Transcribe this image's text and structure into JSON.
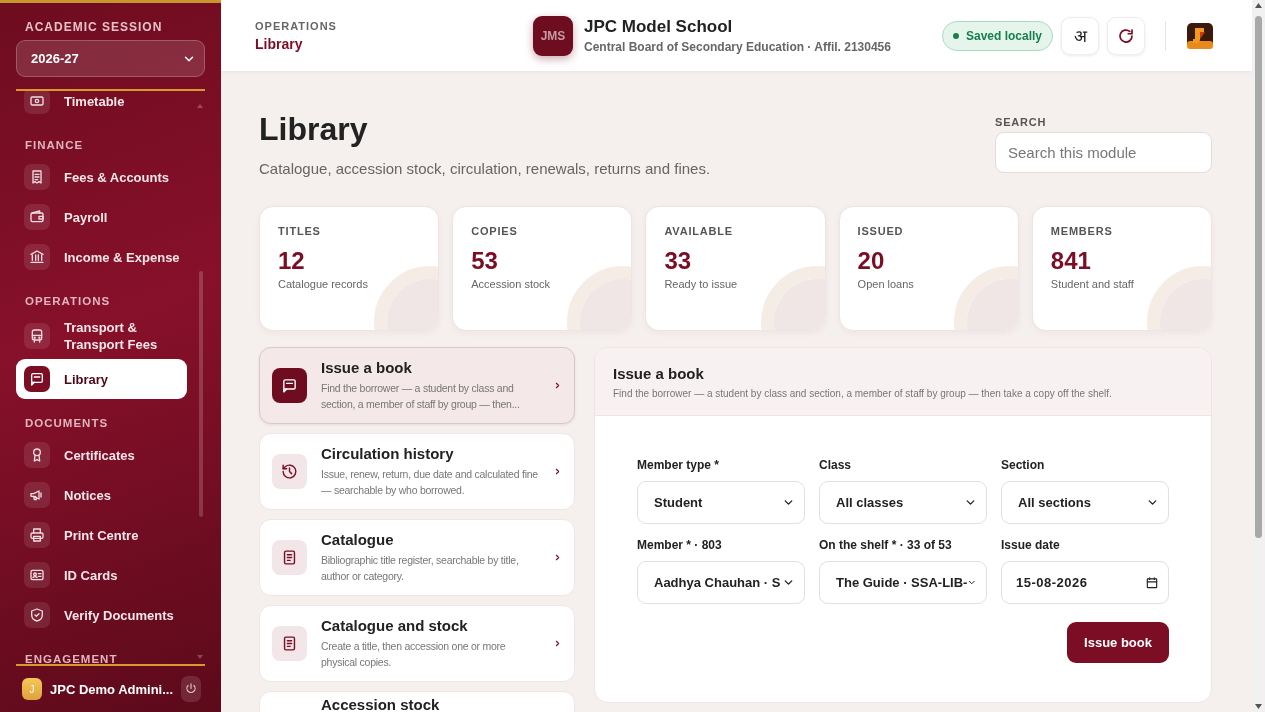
{
  "sidebar": {
    "session_label": "ACADEMIC SESSION",
    "session_value": "2026-27",
    "sections": [
      {
        "items": [
          {
            "label": "Timetable",
            "selected": false
          }
        ]
      },
      {
        "title": "FINANCE",
        "items": [
          {
            "label": "Fees & Accounts",
            "selected": false
          },
          {
            "label": "Payroll",
            "selected": false
          },
          {
            "label": "Income & Expense",
            "selected": false
          }
        ]
      },
      {
        "title": "OPERATIONS",
        "items": [
          {
            "label": "Transport & Transport Fees",
            "selected": false
          },
          {
            "label": "Library",
            "selected": true
          }
        ]
      },
      {
        "title": "DOCUMENTS",
        "items": [
          {
            "label": "Certificates",
            "selected": false
          },
          {
            "label": "Notices",
            "selected": false
          },
          {
            "label": "Print Centre",
            "selected": false
          },
          {
            "label": "ID Cards",
            "selected": false
          },
          {
            "label": "Verify Documents",
            "selected": false
          }
        ]
      },
      {
        "title": "ENGAGEMENT"
      }
    ],
    "user": {
      "initial": "J",
      "name": "JPC Demo Admini..."
    }
  },
  "header": {
    "breadcrumb_section": "OPERATIONS",
    "breadcrumb_page": "Library",
    "school_badge": "JMS",
    "school_name": "JPC Model School",
    "school_subtitle": "Central Board of Secondary Education · Affil. 2130456",
    "status": "Saved locally",
    "language_button": "अ"
  },
  "page": {
    "title": "Library",
    "subtitle": "Catalogue, accession stock, circulation, renewals, returns and fines.",
    "search": {
      "label": "SEARCH",
      "placeholder": "Search this module"
    }
  },
  "stats": [
    {
      "label": "TITLES",
      "value": "12",
      "note": "Catalogue records"
    },
    {
      "label": "COPIES",
      "value": "53",
      "note": "Accession stock"
    },
    {
      "label": "AVAILABLE",
      "value": "33",
      "note": "Ready to issue"
    },
    {
      "label": "ISSUED",
      "value": "20",
      "note": "Open loans"
    },
    {
      "label": "MEMBERS",
      "value": "841",
      "note": "Student and staff"
    }
  ],
  "modules": [
    {
      "title": "Issue a book",
      "description": "Find the borrower — a student by class and section, a member of staff by group — then...",
      "selected": true
    },
    {
      "title": "Circulation history",
      "description": "Issue, renew, return, due date and calculated fine — searchable by who borrowed.",
      "selected": false
    },
    {
      "title": "Catalogue",
      "description": "Bibliographic title register, searchable by title, author or category.",
      "selected": false
    },
    {
      "title": "Catalogue and stock",
      "description": "Create a title, then accession one or more physical copies.",
      "selected": false
    },
    {
      "title": "Accession stock",
      "selected": false
    }
  ],
  "form": {
    "title": "Issue a book",
    "description": "Find the borrower — a student by class and section, a member of staff by group — then take a copy off the shelf.",
    "fields": [
      {
        "label": "Member type *",
        "kind": "select",
        "value": "Student"
      },
      {
        "label": "Class",
        "kind": "select",
        "value": "All classes"
      },
      {
        "label": "Section",
        "kind": "select",
        "value": "All sections"
      },
      {
        "label": "Member * · 803",
        "kind": "select",
        "value": "Aadhya Chauhan · S"
      },
      {
        "label": "On the shelf * · 33 of 53",
        "kind": "select",
        "value": "The Guide · SSA-LIB-"
      },
      {
        "label": "Issue date",
        "kind": "date",
        "value": "15-08-2026"
      }
    ],
    "submit": "Issue book"
  }
}
